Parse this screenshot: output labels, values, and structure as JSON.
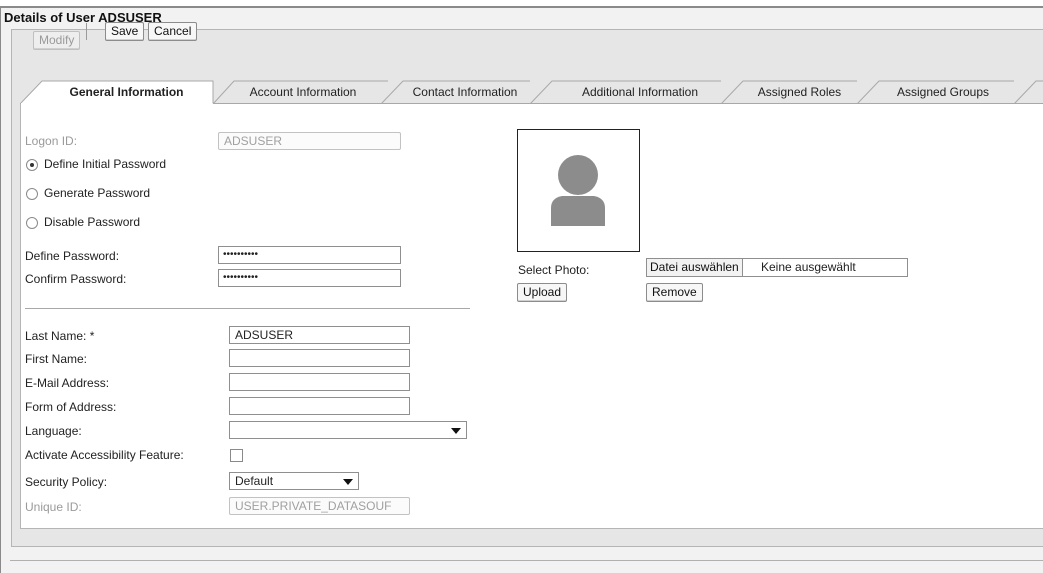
{
  "window": {
    "title": "Details of User ADSUSER"
  },
  "toolbar": {
    "modify_label": "Modify",
    "save_label": "Save",
    "cancel_label": "Cancel"
  },
  "tabs": [
    {
      "label": "General Information",
      "active": true
    },
    {
      "label": "Account Information",
      "active": false
    },
    {
      "label": "Contact Information",
      "active": false
    },
    {
      "label": "Additional Information",
      "active": false
    },
    {
      "label": "Assigned Roles",
      "active": false
    },
    {
      "label": "Assigned Groups",
      "active": false
    }
  ],
  "general": {
    "logon_id": {
      "label": "Logon ID:",
      "value": "ADSUSER"
    },
    "password_options": [
      {
        "label": "Define Initial Password",
        "checked": true
      },
      {
        "label": "Generate Password",
        "checked": false
      },
      {
        "label": "Disable Password",
        "checked": false
      }
    ],
    "define_password": {
      "label": "Define Password:",
      "value": "••••••••••"
    },
    "confirm_password": {
      "label": "Confirm Password:",
      "value": "••••••••••"
    },
    "last_name": {
      "label": "Last Name: *",
      "value": "ADSUSER"
    },
    "first_name": {
      "label": "First Name:",
      "value": ""
    },
    "email": {
      "label": "E-Mail Address:",
      "value": ""
    },
    "form_of_address": {
      "label": "Form of Address:",
      "value": ""
    },
    "language": {
      "label": "Language:",
      "value": ""
    },
    "accessibility": {
      "label": "Activate Accessibility Feature:",
      "checked": false
    },
    "security_policy": {
      "label": "Security Policy:",
      "value": "Default"
    },
    "unique_id": {
      "label": "Unique ID:",
      "value": "USER.PRIVATE_DATASOUF"
    }
  },
  "photo": {
    "select_label": "Select Photo:",
    "file_button": "Datei auswählen",
    "file_status": "Keine ausgewählt",
    "upload_label": "Upload",
    "remove_label": "Remove"
  }
}
